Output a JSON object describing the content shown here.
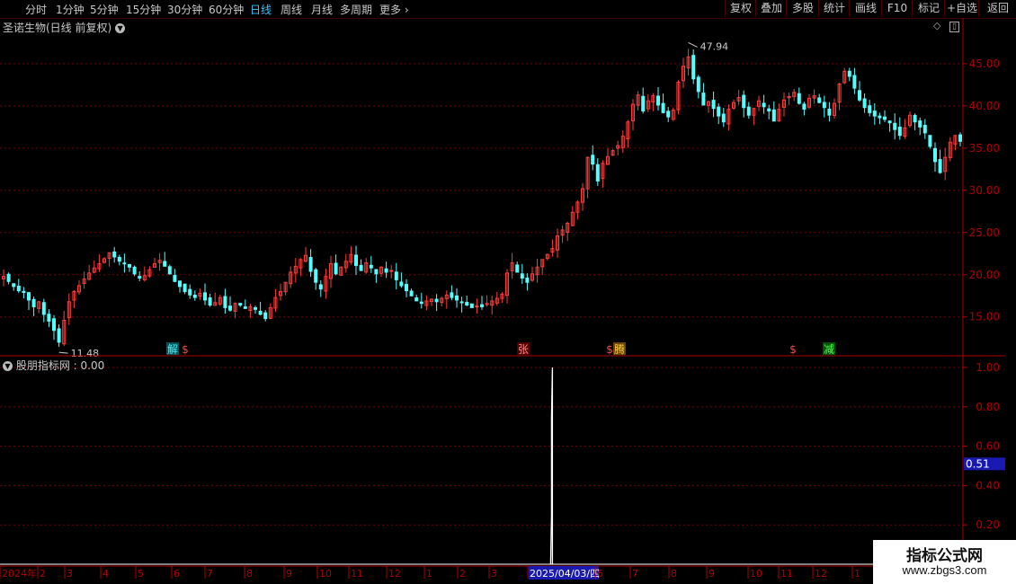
{
  "toolbar": {
    "periods": [
      "分时",
      "1分钟",
      "5分钟",
      "15分钟",
      "30分钟",
      "60分钟",
      "日线",
      "周线",
      "月线",
      "多周期",
      "更多"
    ],
    "active_period": "日线",
    "buttons": [
      "复权",
      "叠加",
      "多股",
      "统计",
      "画线",
      "F10",
      "标记",
      "+自选",
      "返回"
    ]
  },
  "main_chart": {
    "title": "圣诺生物(日线 前复权)",
    "high_label": "47.94",
    "low_label": "11.48",
    "y_ticks": [
      "45.00",
      "40.00",
      "35.00",
      "30.00",
      "25.00",
      "20.00",
      "15.00"
    ],
    "markers": [
      "解",
      "$",
      "张",
      "$",
      "腾",
      "$",
      "减"
    ]
  },
  "indicator": {
    "title": "股朋指标网 : 0.00",
    "y_ticks": [
      "1.00",
      "0.80",
      "0.60",
      "0.40",
      "0.20"
    ],
    "current_value": "0.51"
  },
  "x_axis": {
    "labels": [
      "2024年",
      "2",
      "3",
      "4",
      "5",
      "6",
      "7",
      "8",
      "9",
      "10",
      "11",
      "12",
      "1",
      "2",
      "3",
      "2025/04/03/四",
      "6",
      "7",
      "8",
      "9",
      "10",
      "11",
      "12",
      "1"
    ]
  },
  "watermark": {
    "name": "指标公式网",
    "url": "www.zbgs3.com"
  },
  "colors": {
    "up": "#ff3b3b",
    "down": "#54ffff",
    "grid": "#7a0000",
    "axis": "#b00000"
  },
  "chart_data": {
    "type": "candlestick",
    "price_range": [
      10.5,
      48.5
    ],
    "close_series": [
      19.8,
      19.2,
      18.6,
      18.1,
      17.9,
      17.0,
      16.2,
      16.8,
      15.3,
      14.5,
      13.4,
      12.0,
      14.6,
      16.8,
      18.0,
      18.7,
      19.5,
      20.2,
      20.8,
      21.3,
      21.9,
      22.6,
      22.1,
      21.6,
      21.3,
      20.9,
      20.1,
      19.6,
      19.9,
      20.6,
      21.3,
      21.7,
      21.0,
      20.1,
      19.2,
      18.6,
      18.0,
      17.6,
      17.3,
      17.8,
      17.0,
      16.4,
      16.7,
      17.3,
      16.1,
      15.8,
      16.6,
      16.4,
      16.0,
      16.2,
      15.9,
      15.3,
      14.8,
      16.1,
      17.3,
      18.0,
      19.1,
      20.3,
      21.0,
      21.8,
      22.3,
      20.4,
      19.1,
      18.3,
      19.8,
      21.3,
      20.1,
      20.9,
      21.6,
      22.4,
      21.1,
      20.5,
      21.4,
      20.8,
      20.1,
      20.9,
      20.3,
      20.5,
      19.4,
      18.7,
      18.1,
      17.5,
      16.9,
      16.6,
      16.9,
      17.1,
      16.8,
      17.2,
      17.6,
      17.3,
      17.0,
      16.7,
      16.4,
      16.1,
      16.3,
      16.2,
      16.6,
      16.9,
      17.2,
      17.7,
      20.2,
      21.4,
      20.3,
      19.6,
      19.1,
      20.1,
      20.9,
      21.8,
      22.4,
      23.1,
      24.6,
      25.3,
      26.1,
      27.4,
      28.6,
      30.2,
      33.9,
      33.1,
      31.1,
      33.2,
      34.0,
      34.7,
      35.3,
      36.4,
      38.1,
      40.2,
      41.3,
      39.4,
      40.6,
      41.2,
      40.1,
      39.2,
      38.7,
      39.5,
      42.8,
      44.7,
      45.8,
      43.2,
      41.7,
      40.1,
      40.5,
      39.7,
      38.8,
      38.1,
      39.6,
      40.4,
      41.0,
      39.8,
      38.9,
      39.7,
      40.6,
      39.9,
      39.4,
      38.2,
      39.6,
      40.7,
      41.1,
      41.6,
      40.3,
      39.6,
      40.9,
      41.2,
      40.4,
      39.8,
      38.9,
      40.3,
      42.6,
      44.1,
      43.5,
      42.1,
      40.7,
      39.8,
      39.2,
      38.8,
      38.6,
      38.4,
      38.0,
      37.2,
      36.5,
      37.4,
      38.9,
      38.1,
      37.5,
      36.8,
      35.2,
      33.4,
      32.1,
      33.9,
      35.7,
      36.5,
      35.8
    ]
  },
  "indicator_data": {
    "type": "spike",
    "range": [
      0,
      1.05
    ],
    "spike": {
      "candle_index": 109,
      "value": 1.0
    }
  }
}
